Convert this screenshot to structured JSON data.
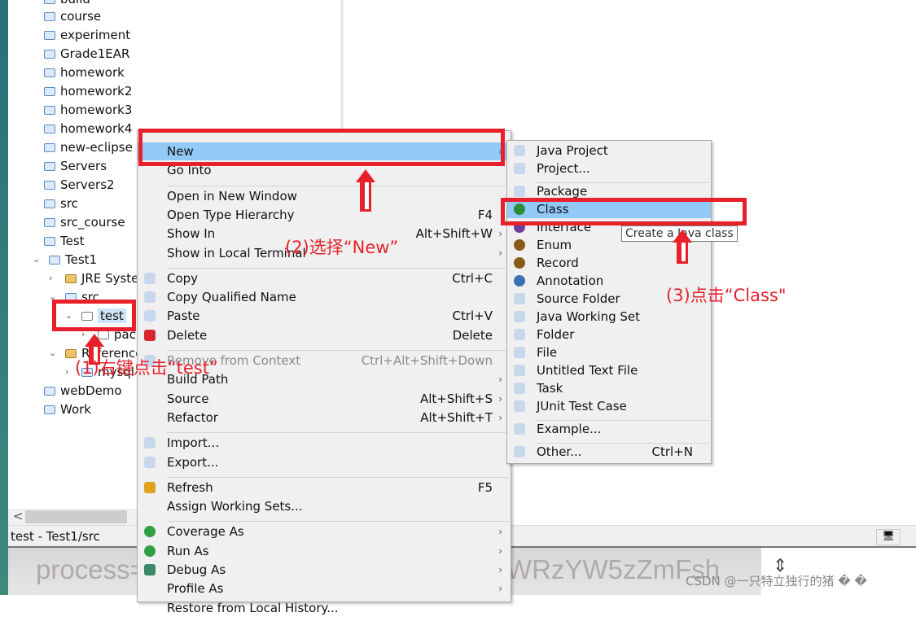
{
  "tree": {
    "items": [
      {
        "label": "build",
        "kind": "folder"
      },
      {
        "label": "course",
        "kind": "folder"
      },
      {
        "label": "experiment",
        "kind": "folder"
      },
      {
        "label": "Grade1EAR",
        "kind": "folder"
      },
      {
        "label": "homework",
        "kind": "folder"
      },
      {
        "label": "homework2",
        "kind": "folder"
      },
      {
        "label": "homework3",
        "kind": "folder"
      },
      {
        "label": "homework4",
        "kind": "folder"
      },
      {
        "label": "new-eclipse",
        "kind": "folder"
      },
      {
        "label": "Servers",
        "kind": "folder"
      },
      {
        "label": "Servers2",
        "kind": "folder"
      },
      {
        "label": "src",
        "kind": "folder"
      },
      {
        "label": "src_course",
        "kind": "folder"
      },
      {
        "label": "Test",
        "kind": "folder"
      },
      {
        "label": "Test1",
        "kind": "project",
        "expanded": true
      },
      {
        "label": "JRE System",
        "kind": "library",
        "indent": 1
      },
      {
        "label": "src",
        "kind": "source",
        "indent": 1,
        "expanded": true
      },
      {
        "label": "test",
        "kind": "package",
        "indent": 2,
        "expanded": true,
        "selected": true
      },
      {
        "label": "pack",
        "kind": "file",
        "indent": 3
      },
      {
        "label": "Reference",
        "kind": "library",
        "indent": 1,
        "expanded": true
      },
      {
        "label": "mysql",
        "kind": "jar",
        "indent": 2
      },
      {
        "label": "webDemo",
        "kind": "folder"
      },
      {
        "label": "Work",
        "kind": "folder"
      }
    ]
  },
  "status": {
    "text": "test - Test1/src"
  },
  "background_text": {
    "left": "process=",
    "right": "WRzYW5zZmFsh"
  },
  "watermark": "CSDN @一只特立独行的猪 � �",
  "context_menu": {
    "items": [
      {
        "label": "New",
        "arrow": true,
        "highlighted": true
      },
      {
        "label": "Go Into"
      },
      {
        "sep": true
      },
      {
        "label": "Open in New Window"
      },
      {
        "label": "Open Type Hierarchy",
        "accel": "F4"
      },
      {
        "label": "Show In",
        "accel": "Alt+Shift+W",
        "arrow": true
      },
      {
        "label": "Show in Local Terminal",
        "arrow": true
      },
      {
        "sep": true
      },
      {
        "label": "Copy",
        "accel": "Ctrl+C",
        "icon": "copy-icon"
      },
      {
        "label": "Copy Qualified Name",
        "icon": "copy-qualified-icon"
      },
      {
        "label": "Paste",
        "accel": "Ctrl+V",
        "icon": "paste-icon"
      },
      {
        "label": "Delete",
        "accel": "Delete",
        "icon": "delete-icon"
      },
      {
        "sep": true
      },
      {
        "label": "Remove from Context",
        "accel": "Ctrl+Alt+Shift+Down",
        "disabled": true,
        "icon": "remove-context-icon"
      },
      {
        "label": "Build Path",
        "arrow": true
      },
      {
        "label": "Source",
        "accel": "Alt+Shift+S",
        "arrow": true
      },
      {
        "label": "Refactor",
        "accel": "Alt+Shift+T",
        "arrow": true
      },
      {
        "sep": true
      },
      {
        "label": "Import...",
        "icon": "import-icon"
      },
      {
        "label": "Export...",
        "icon": "export-icon"
      },
      {
        "sep": true
      },
      {
        "label": "Refresh",
        "accel": "F5",
        "icon": "refresh-icon"
      },
      {
        "label": "Assign Working Sets..."
      },
      {
        "sep": true
      },
      {
        "label": "Coverage As",
        "arrow": true,
        "icon": "coverage-icon"
      },
      {
        "label": "Run As",
        "arrow": true,
        "icon": "run-icon"
      },
      {
        "label": "Debug As",
        "arrow": true,
        "icon": "debug-icon"
      },
      {
        "label": "Profile As",
        "arrow": true
      },
      {
        "label": "Restore from Local History..."
      }
    ]
  },
  "submenu": {
    "items": [
      {
        "label": "Java Project",
        "icon": "java-project-icon"
      },
      {
        "label": "Project...",
        "icon": "project-icon"
      },
      {
        "sep": true
      },
      {
        "label": "Package",
        "icon": "package-icon"
      },
      {
        "label": "Class",
        "icon": "class-icon",
        "highlighted": true
      },
      {
        "label": "Interface",
        "icon": "interface-icon"
      },
      {
        "label": "Enum",
        "icon": "enum-icon"
      },
      {
        "label": "Record",
        "icon": "record-icon"
      },
      {
        "label": "Annotation",
        "icon": "annotation-icon"
      },
      {
        "label": "Source Folder",
        "icon": "source-folder-icon"
      },
      {
        "label": "Java Working Set",
        "icon": "working-set-icon"
      },
      {
        "label": "Folder",
        "icon": "folder-icon"
      },
      {
        "label": "File",
        "icon": "file-icon"
      },
      {
        "label": "Untitled Text File",
        "icon": "text-file-icon"
      },
      {
        "label": "Task",
        "icon": "task-icon"
      },
      {
        "label": "JUnit Test Case",
        "icon": "junit-icon"
      },
      {
        "sep": true
      },
      {
        "label": "Example...",
        "icon": "example-icon"
      },
      {
        "sep": true
      },
      {
        "label": "Other...",
        "accel": "Ctrl+N",
        "icon": "other-icon"
      }
    ]
  },
  "tooltip": "Create a Java class",
  "annotations": {
    "step1": "(1)右键点击“test”",
    "step2": "(2)选择“New”",
    "step3": "(3)点击“Class\""
  },
  "colors": {
    "highlight": "#91c9f7",
    "annotation": "#e8202a",
    "selection": "#cce4f7"
  }
}
